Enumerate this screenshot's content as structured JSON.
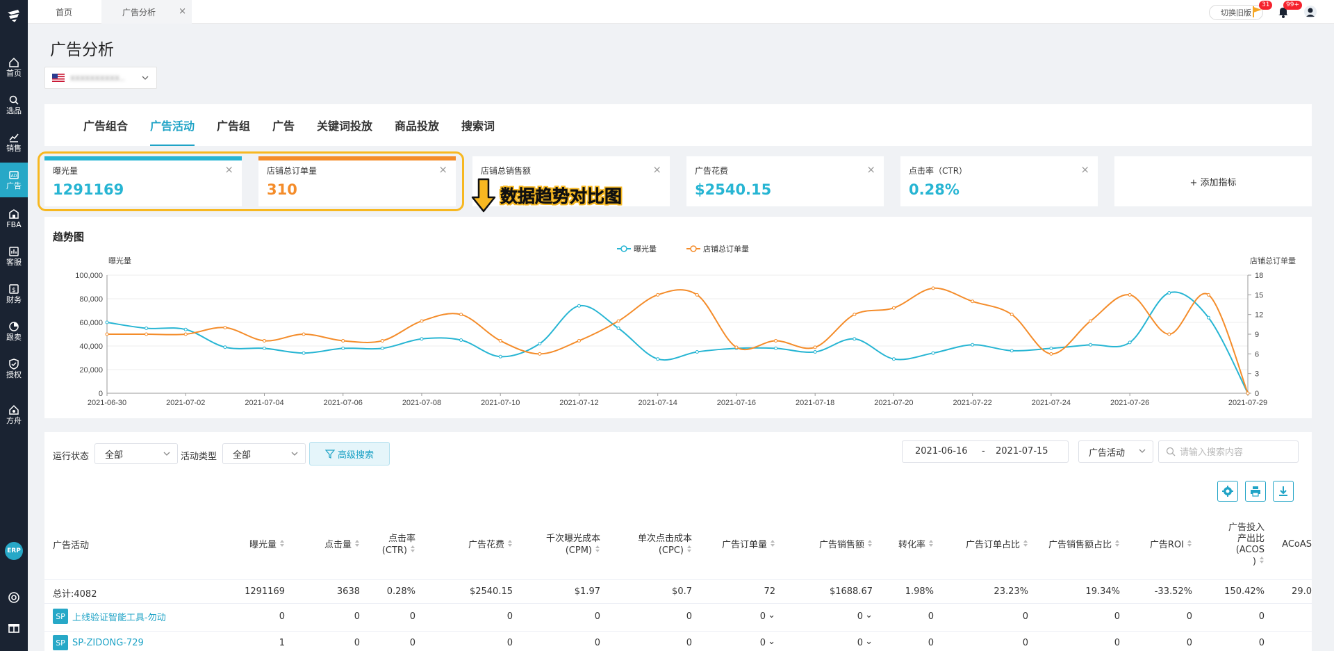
{
  "sidebar": {
    "items": [
      {
        "label": "首页",
        "icon": "home-icon"
      },
      {
        "label": "选品",
        "icon": "search-icon"
      },
      {
        "label": "销售",
        "icon": "chart-icon"
      },
      {
        "label": "广告",
        "icon": "ad-icon",
        "active": true
      },
      {
        "label": "FBA",
        "icon": "warehouse-icon"
      },
      {
        "label": "客服",
        "icon": "report-icon"
      },
      {
        "label": "财务",
        "icon": "dollar-icon"
      },
      {
        "label": "跟卖",
        "icon": "pie-icon"
      },
      {
        "label": "授权",
        "icon": "shield-icon"
      },
      {
        "label": "方舟",
        "icon": "ark-icon"
      }
    ],
    "erp_label": "ERP"
  },
  "topbar": {
    "tabs": [
      {
        "label": "首页"
      },
      {
        "label": "广告分析",
        "close": "×"
      }
    ],
    "switch_label": "切换旧版",
    "flag_badge": "31",
    "bell_badge": "99+"
  },
  "page": {
    "title": "广告分析",
    "store_value": "xxxxxxxxxx.."
  },
  "main_tabs": [
    "广告组合",
    "广告活动",
    "广告组",
    "广告",
    "关键词投放",
    "商品投放",
    "搜索词"
  ],
  "active_tab": "广告活动",
  "metric_cards": [
    {
      "name": "曝光量",
      "value": "1291169",
      "color": "#27b5d3"
    },
    {
      "name": "店铺总订单量",
      "value": "310",
      "color": "#f48c2a"
    },
    {
      "name": "店铺总销售额",
      "value": "",
      "color": "#1fa3c6"
    },
    {
      "name": "广告花费",
      "value": "$2540.15",
      "color": "#27b5d3"
    },
    {
      "name": "点击率（CTR）",
      "value": "0.28%",
      "color": "#27b5d3"
    }
  ],
  "add_metric_label": "+ 添加指标",
  "annotation": "数据趋势对比图",
  "chart_data": {
    "type": "line",
    "title": "趋势图",
    "y_left_label": "曝光量",
    "y_right_label": "店铺总订单量",
    "x": [
      "2021-06-30",
      "2021-07-01",
      "2021-07-02",
      "2021-07-03",
      "2021-07-04",
      "2021-07-05",
      "2021-07-06",
      "2021-07-07",
      "2021-07-08",
      "2021-07-09",
      "2021-07-10",
      "2021-07-11",
      "2021-07-12",
      "2021-07-13",
      "2021-07-14",
      "2021-07-15",
      "2021-07-16",
      "2021-07-17",
      "2021-07-18",
      "2021-07-19",
      "2021-07-20",
      "2021-07-21",
      "2021-07-22",
      "2021-07-23",
      "2021-07-24",
      "2021-07-25",
      "2021-07-26",
      "2021-07-27",
      "2021-07-28",
      "2021-07-29"
    ],
    "x_tick_labels": [
      "2021-06-30",
      "2021-07-02",
      "2021-07-04",
      "2021-07-06",
      "2021-07-08",
      "2021-07-10",
      "2021-07-12",
      "2021-07-14",
      "2021-07-16",
      "2021-07-18",
      "2021-07-20",
      "2021-07-22",
      "2021-07-24",
      "2021-07-26",
      "2021-07-29"
    ],
    "y_left_ticks": [
      "0",
      "20,000",
      "40,000",
      "60,000",
      "80,000",
      "100,000"
    ],
    "y_left_range": [
      0,
      100000
    ],
    "y_right_ticks": [
      "0",
      "3",
      "6",
      "9",
      "12",
      "15",
      "18"
    ],
    "y_right_range": [
      0,
      18
    ],
    "series": [
      {
        "name": "曝光量",
        "axis": "left",
        "color": "#27b5d3",
        "values": [
          60000,
          55000,
          54000,
          39000,
          38000,
          34000,
          38000,
          38000,
          46000,
          45000,
          31000,
          42000,
          74000,
          55000,
          29000,
          35000,
          38000,
          38000,
          35000,
          46000,
          29000,
          34000,
          41000,
          36000,
          38000,
          41000,
          43000,
          85000,
          64000,
          0
        ]
      },
      {
        "name": "店铺总订单量",
        "axis": "right",
        "color": "#f48c2a",
        "values": [
          9,
          9,
          9,
          10,
          8,
          9,
          8,
          8,
          11,
          12,
          8,
          6,
          8,
          11,
          15,
          15,
          7,
          8,
          7,
          12,
          13,
          16,
          14,
          12,
          6,
          11,
          15,
          9,
          15,
          0
        ]
      }
    ],
    "legend_position": "top-center",
    "grid": true
  },
  "filters": {
    "status_label": "运行状态",
    "status_value": "全部",
    "type_label": "活动类型",
    "type_value": "全部",
    "advanced_label": "高级搜索",
    "date_start": "2021-06-16",
    "date_sep": "-",
    "date_end": "2021-07-15",
    "scope_value": "广告活动",
    "search_placeholder": "请输入搜索内容"
  },
  "table": {
    "columns": [
      "广告活动",
      "曝光量",
      "点击量",
      "点击率\n(CTR)",
      "广告花费",
      "千次曝光成本\n(CPM)",
      "单次点击成本\n(CPC)",
      "广告订单量",
      "广告销售额",
      "转化率",
      "广告订单占比",
      "广告销售额占比",
      "广告ROI",
      "广告投入\n产出比\n(ACOS\n)",
      "ACoAS"
    ],
    "total_row": [
      "总计:4082",
      "1291169",
      "3638",
      "0.28%",
      "$2540.15",
      "$1.97",
      "$0.7",
      "72",
      "$1688.67",
      "1.98%",
      "23.23%",
      "19.34%",
      "-33.52%",
      "150.42%",
      "29.0"
    ],
    "rows": [
      {
        "badge": "SP",
        "name": "上线验证智能工具-勿动",
        "values": [
          "0",
          "0",
          "0",
          "0",
          "0",
          "0",
          "0",
          "0",
          "0",
          "0",
          "0",
          "0",
          "0"
        ]
      },
      {
        "badge": "SP",
        "name": "SP-ZIDONG-729",
        "values": [
          "1",
          "0",
          "0",
          "0",
          "0",
          "0",
          "0",
          "0",
          "0",
          "0",
          "0",
          "0",
          "0"
        ]
      }
    ]
  }
}
